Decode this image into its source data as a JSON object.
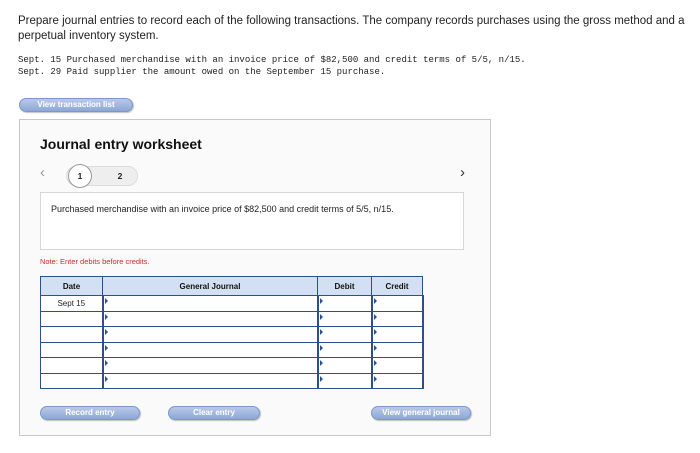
{
  "instructions": "Prepare journal entries to record each of the following transactions. The company records purchases using the gross method and a perpetual inventory system.",
  "transactions": [
    "Sept. 15 Purchased merchandise with an invoice price of $82,500 and credit terms of 5/5, n/15.",
    "Sept. 29 Paid supplier the amount owed on the September 15 purchase."
  ],
  "view_transaction_list_label": "View transaction list",
  "worksheet": {
    "title": "Journal entry worksheet",
    "nav_prev_icon": "chevron-left-icon",
    "nav_next_icon": "chevron-right-icon",
    "steps": [
      "1",
      "2"
    ],
    "current_step": "1",
    "description": "Purchased merchandise with an invoice price of $82,500 and credit terms of 5/5, n/15.",
    "note": "Note: Enter debits before credits.",
    "table": {
      "headers": {
        "date": "Date",
        "general_journal": "General Journal",
        "debit": "Debit",
        "credit": "Credit"
      },
      "rows": [
        {
          "date": "Sept 15",
          "account": "",
          "debit": "",
          "credit": ""
        },
        {
          "date": "",
          "account": "",
          "debit": "",
          "credit": ""
        },
        {
          "date": "",
          "account": "",
          "debit": "",
          "credit": ""
        },
        {
          "date": "",
          "account": "",
          "debit": "",
          "credit": ""
        },
        {
          "date": "",
          "account": "",
          "debit": "",
          "credit": ""
        },
        {
          "date": "",
          "account": "",
          "debit": "",
          "credit": ""
        }
      ]
    },
    "buttons": {
      "record_entry": "Record entry",
      "clear_entry": "Clear entry",
      "view_general_journal": "View general journal"
    }
  },
  "colors": {
    "table_border": "#2d4f8a",
    "header_bg": "#d3e0f3",
    "button_bg": "#8da7d6",
    "note_text": "#c4302b"
  }
}
